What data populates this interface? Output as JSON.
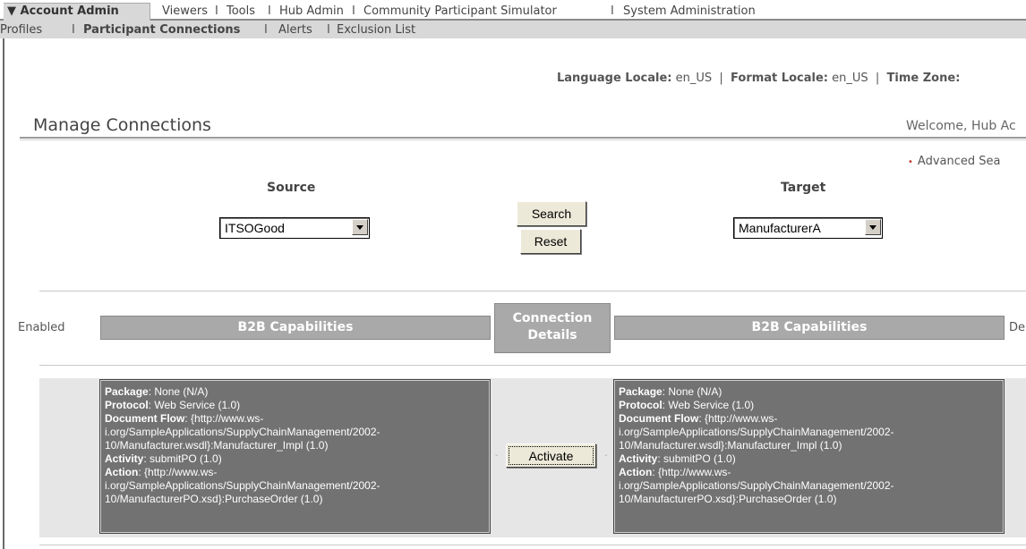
{
  "nav": {
    "tabs": [
      "Account Admin",
      "Viewers",
      "Tools",
      "Hub Admin",
      "Community Participant Simulator",
      "System Administration"
    ],
    "active_tab_marker": "▼",
    "subtabs": [
      "Profiles",
      "Participant Connections",
      "Alerts",
      "Exclusion List"
    ],
    "active_subtab": "Participant Connections",
    "separator": "I"
  },
  "locale": {
    "language_label": "Language Locale:",
    "language_value": "en_US",
    "format_label": "Format Locale:",
    "format_value": "en_US",
    "timezone_label": "Time Zone:"
  },
  "page": {
    "title": "Manage Connections",
    "welcome": "Welcome, Hub Ac",
    "advanced_search": "Advanced Sea"
  },
  "search": {
    "source_label": "Source",
    "source_value": "ITSOGood",
    "target_label": "Target",
    "target_value": "ManufacturerA",
    "search_button": "Search",
    "reset_button": "Reset"
  },
  "headers": {
    "enabled": "Enabled",
    "left_caps": "B2B Capabilities",
    "connection_details_line1": "Connection",
    "connection_details_line2": "Details",
    "right_caps": "B2B Capabilities",
    "right_cut": "De"
  },
  "connection": {
    "activate_button": "Activate",
    "dash": "-",
    "left": {
      "package_label": "Package",
      "package_value": ": None (N/A)",
      "protocol_label": "Protocol",
      "protocol_value": ": Web Service (1.0)",
      "docflow_label": "Document Flow",
      "docflow_value": ": {http://www.ws-",
      "docflow_cont1": "i.org/SampleApplications/SupplyChainManagement/2002-",
      "docflow_cont2": "10/Manufacturer.wsdl}:Manufacturer_Impl (1.0)",
      "activity_label": "Activity",
      "activity_value": ": submitPO (1.0)",
      "action_label": "Action",
      "action_value": ": {http://www.ws-",
      "action_cont1": "i.org/SampleApplications/SupplyChainManagement/2002-",
      "action_cont2": "10/ManufacturerPO.xsd}:PurchaseOrder (1.0)"
    },
    "right": {
      "package_label": "Package",
      "package_value": ": None (N/A)",
      "protocol_label": "Protocol",
      "protocol_value": ": Web Service (1.0)",
      "docflow_label": "Document Flow",
      "docflow_value": ": {http://www.ws-",
      "docflow_cont1": "i.org/SampleApplications/SupplyChainManagement/2002-",
      "docflow_cont2": "10/Manufacturer.wsdl}:Manufacturer_Impl (1.0)",
      "activity_label": "Activity",
      "activity_value": ": submitPO (1.0)",
      "action_label": "Action",
      "action_value": ": {http://www.ws-",
      "action_cont1": "i.org/SampleApplications/SupplyChainManagement/2002-",
      "action_cont2": "10/ManufacturerPO.xsd}:PurchaseOrder (1.0)"
    }
  }
}
